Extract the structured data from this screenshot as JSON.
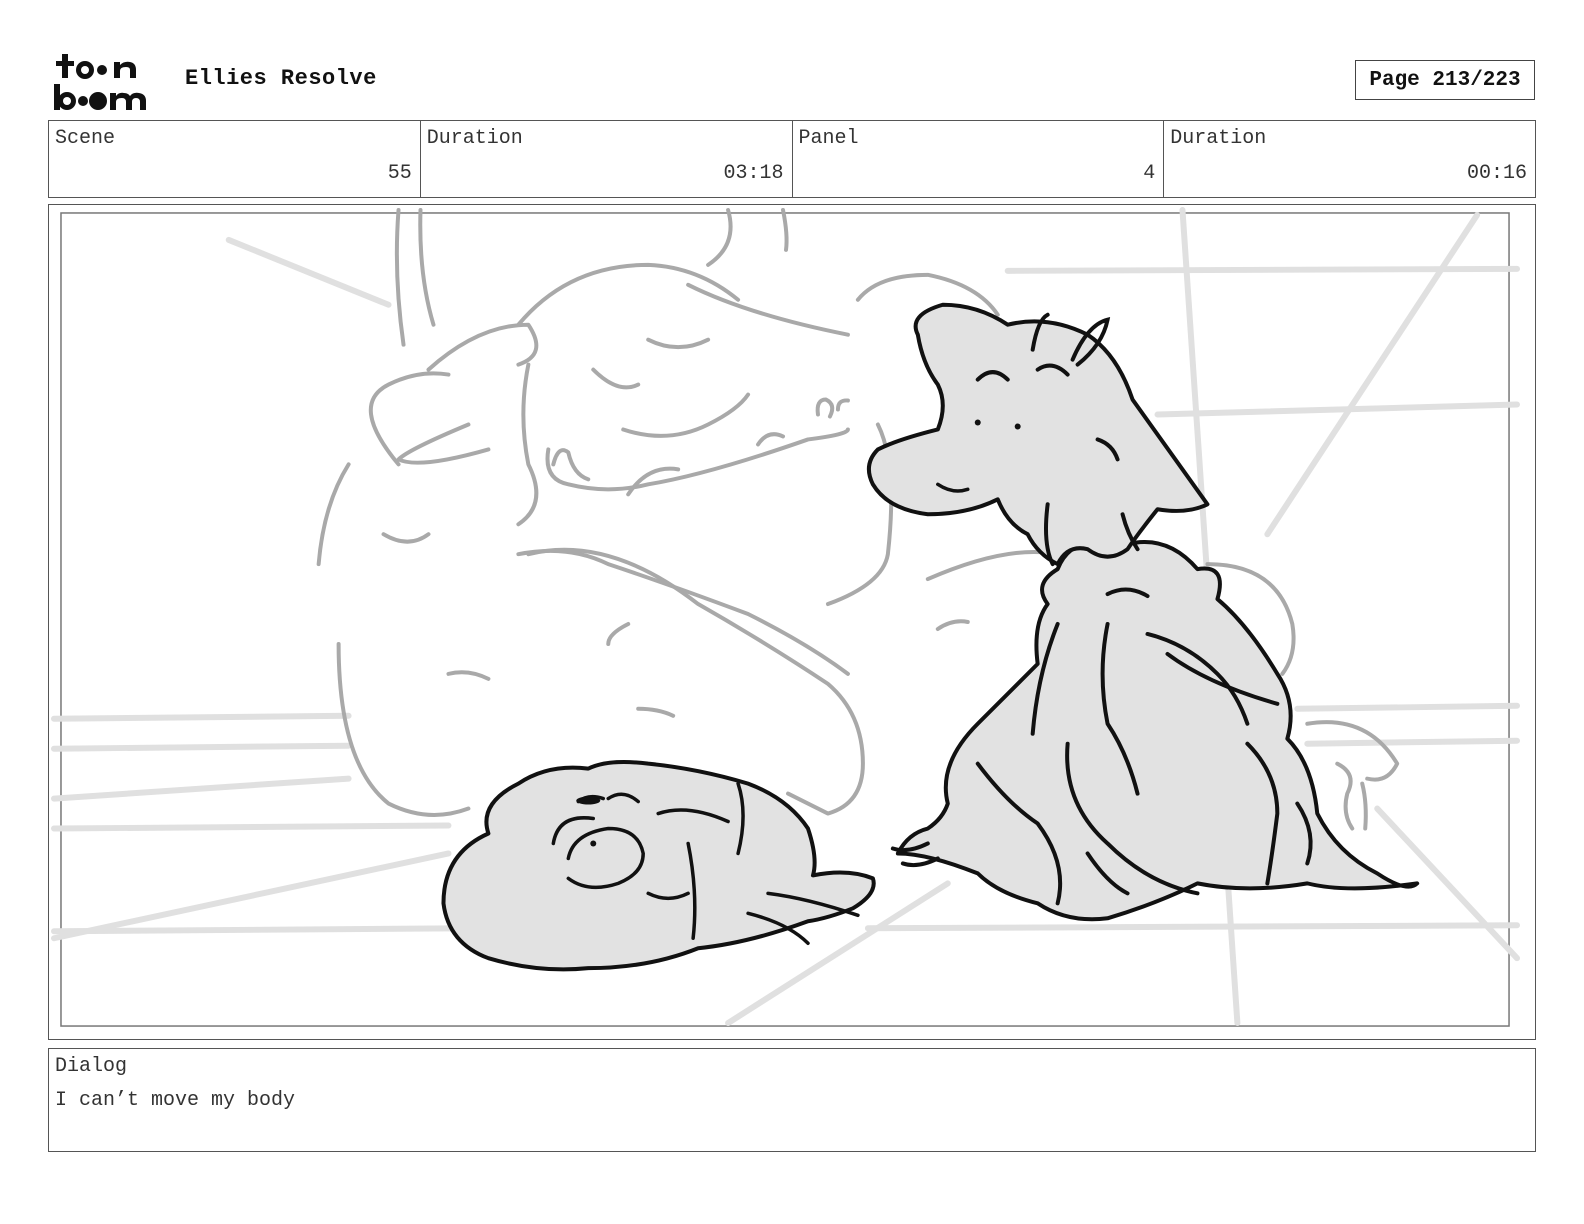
{
  "header": {
    "logo_text": "toon boom",
    "title": "Ellies Resolve",
    "page_indicator": "Page 213/223"
  },
  "info": {
    "scene_label": "Scene",
    "scene_value": "55",
    "scene_duration_label": "Duration",
    "scene_duration_value": "03:18",
    "panel_label": "Panel",
    "panel_value": "4",
    "panel_duration_label": "Duration",
    "panel_duration_value": "00:16"
  },
  "dialog": {
    "label": "Dialog",
    "text": "I can’t move my body"
  },
  "colors": {
    "ink": "#111111",
    "sketch": "#a8a8a8",
    "shade": "#e2e2e2",
    "border": "#555555"
  }
}
